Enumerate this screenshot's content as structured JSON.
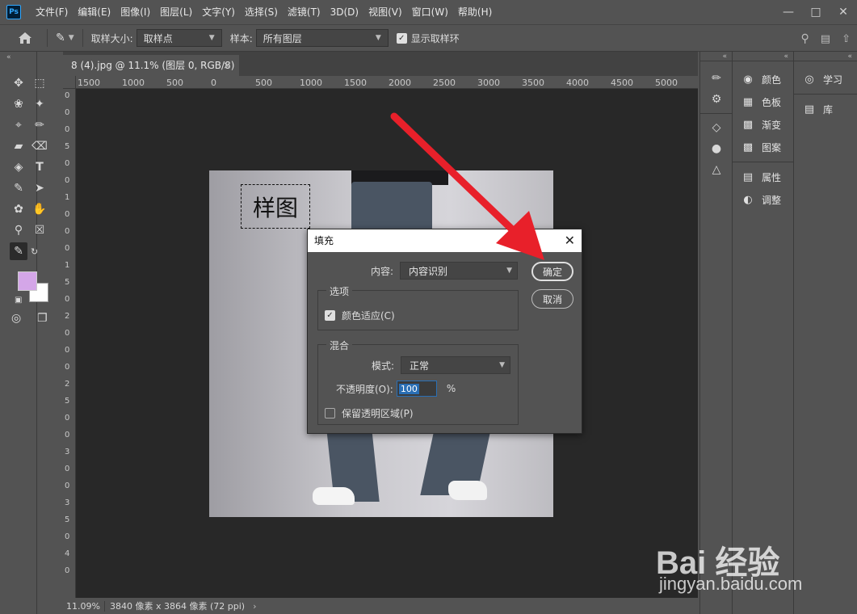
{
  "app": {
    "logo_text": "Ps"
  },
  "menu": [
    "文件(F)",
    "编辑(E)",
    "图像(I)",
    "图层(L)",
    "文字(Y)",
    "选择(S)",
    "滤镜(T)",
    "3D(D)",
    "视图(V)",
    "窗口(W)",
    "帮助(H)"
  ],
  "options": {
    "sample_size_label": "取样大小:",
    "sample_size_value": "取样点",
    "sample_label": "样本:",
    "sample_value": "所有图层",
    "show_ring_label": "显示取样环"
  },
  "document": {
    "tab_title": "8 (4).jpg @ 11.1% (图层 0, RGB/8) *",
    "ruler_h": [
      "1500",
      "1000",
      "500",
      "0",
      "500",
      "1000",
      "1500",
      "2000",
      "2500",
      "3000",
      "3500",
      "4000",
      "4500",
      "5000"
    ],
    "ruler_v": [
      "0",
      "0",
      "0",
      "5",
      "0",
      "0",
      "1",
      "0",
      "0",
      "0",
      "1",
      "5",
      "0",
      "2",
      "0",
      "0",
      "0",
      "2",
      "5",
      "0",
      "0",
      "3",
      "0",
      "0",
      "3",
      "5",
      "0",
      "4",
      "0"
    ],
    "selection_text": "样图"
  },
  "status": {
    "zoom": "11.09%",
    "info": "3840 像素 x 3864 像素 (72 ppi)"
  },
  "dialog": {
    "title": "填充",
    "content_label": "内容:",
    "content_value": "内容识别",
    "options_group": "选项",
    "color_adapt": "颜色适应(C)",
    "blend_group": "混合",
    "mode_label": "模式:",
    "mode_value": "正常",
    "opacity_label": "不透明度(O):",
    "opacity_value": "100",
    "opacity_unit": "%",
    "preserve_label": "保留透明区域(P)",
    "ok": "确定",
    "cancel": "取消"
  },
  "panels": {
    "col2": [
      "颜色",
      "色板",
      "渐变",
      "图案",
      "属性",
      "调整"
    ],
    "col3": [
      "学习",
      "库"
    ]
  },
  "watermark": {
    "brand": "Bai 经验",
    "url": "jingyan.baidu.com"
  },
  "colors": {
    "foreground": "#d4a6e8",
    "background": "#ffffff",
    "arrow": "#e8202a"
  }
}
